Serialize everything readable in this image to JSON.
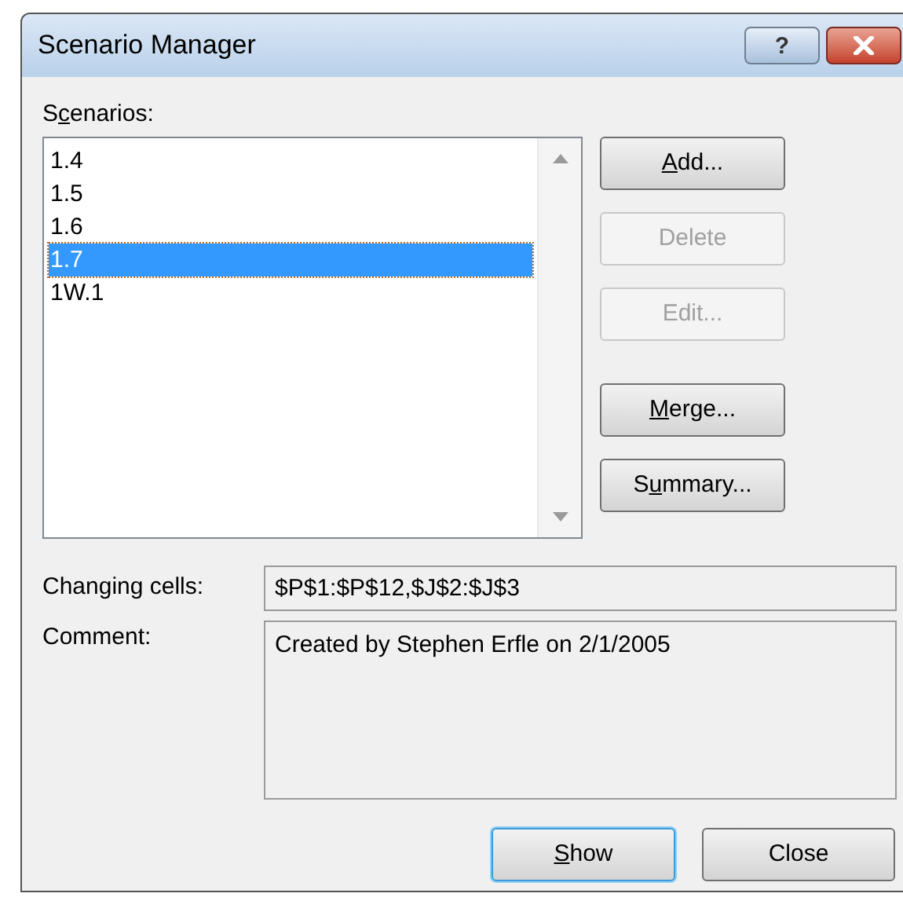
{
  "window": {
    "title": "Scenario Manager",
    "title_buttons": [
      {
        "kind": "help",
        "label": "?"
      },
      {
        "kind": "close"
      }
    ]
  },
  "scenarios_label": {
    "pre": "S",
    "key": "c",
    "post": "enarios:"
  },
  "scenarios": [
    {
      "name": "1.4",
      "selected": false
    },
    {
      "name": "1.5",
      "selected": false
    },
    {
      "name": "1.6",
      "selected": false
    },
    {
      "name": "1.7",
      "selected": true
    },
    {
      "name": "1W.1",
      "selected": false
    }
  ],
  "side_button_groups": [
    [
      {
        "key": "A",
        "post": "dd...",
        "disabled": false
      },
      {
        "pre": "Delete",
        "disabled": true
      },
      {
        "pre": "Edit...",
        "disabled": true
      }
    ],
    [
      {
        "key": "M",
        "post": "erge...",
        "disabled": false
      },
      {
        "pre": "S",
        "key": "u",
        "post": "mmary...",
        "disabled": false
      }
    ]
  ],
  "changing_cells": {
    "label": "Changing cells:",
    "value": "$P$1:$P$12,$J$2:$J$3"
  },
  "comment": {
    "label": "Comment:",
    "value": "Created by Stephen Erfle on 2/1/2005"
  },
  "footer_buttons": [
    {
      "key": "S",
      "post": "how",
      "default": true
    },
    {
      "pre": "Close",
      "default": false
    }
  ]
}
